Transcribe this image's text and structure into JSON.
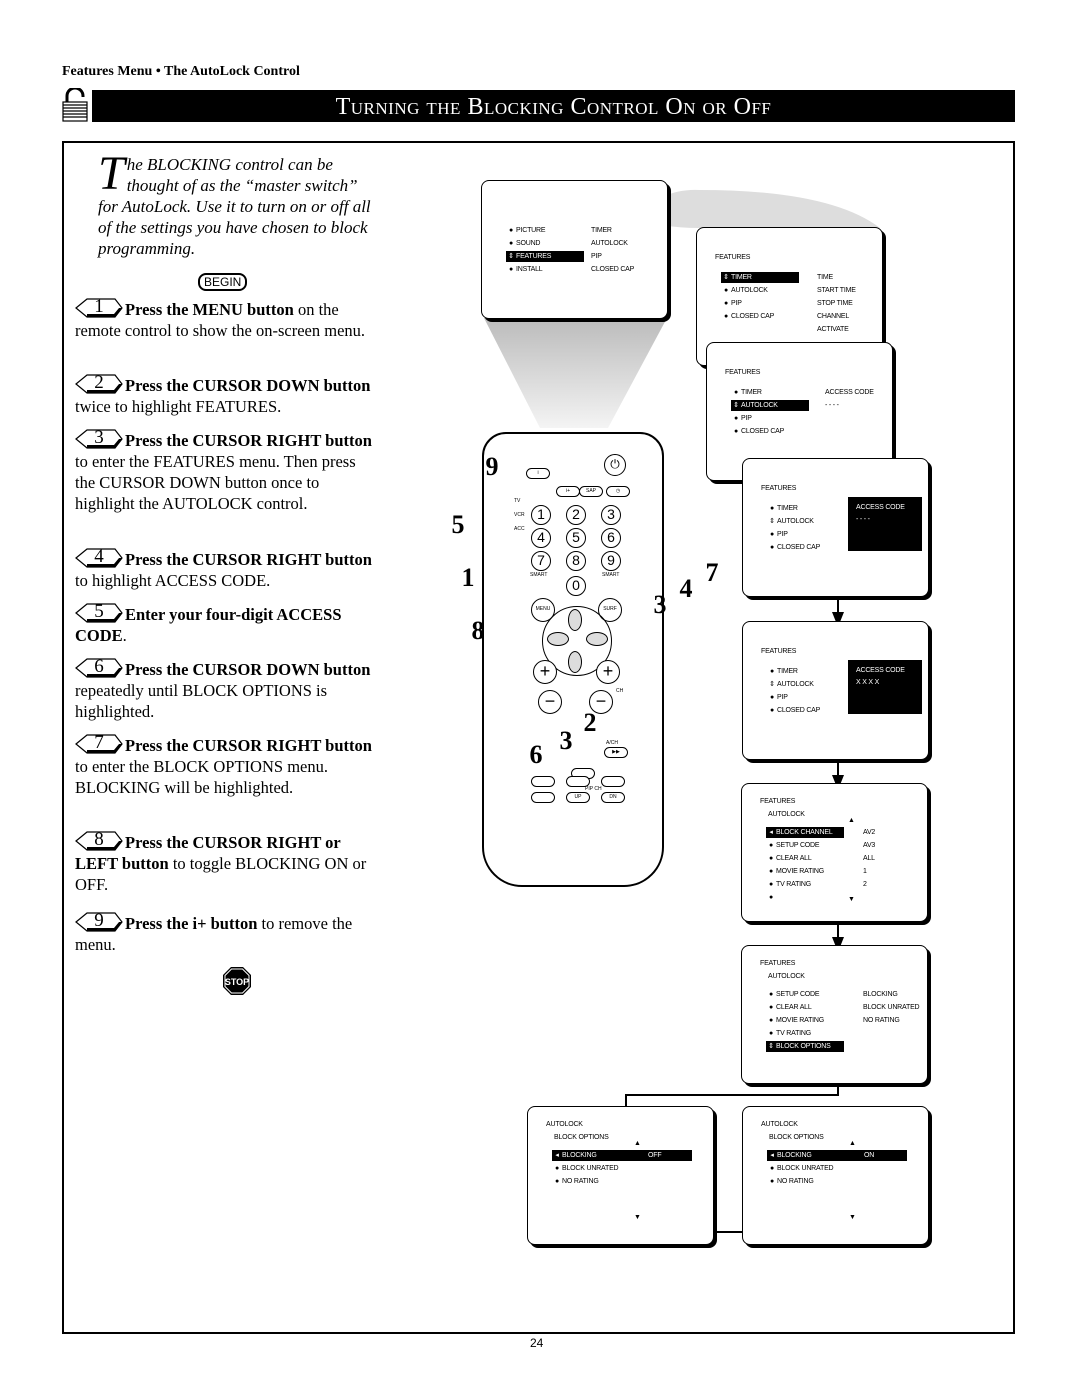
{
  "header": {
    "breadcrumb": "Features Menu • The AutoLock Control",
    "title": "Turning the Blocking Control On or Off",
    "icon": "padlock-open-icon"
  },
  "intro": {
    "drop_cap": "T",
    "text": "he BLOCKING control can be thought of as the “master switch” for AutoLock. Use it to turn on or off all of the settings you have chosen to block programming.",
    "begin_label": "BEGIN"
  },
  "steps": [
    {
      "num": "1",
      "bold": "Press the MENU button",
      "text": " on the remote control to show the on-screen menu."
    },
    {
      "num": "2",
      "bold": "Press the CURSOR DOWN button",
      "text": " twice to highlight FEATURES."
    },
    {
      "num": "3",
      "bold": "Press the CURSOR RIGHT button",
      "text": " to enter the FEATURES menu. Then press the CURSOR DOWN button once to highlight the AUTOLOCK control."
    },
    {
      "num": "4",
      "bold": "Press the CURSOR RIGHT button",
      "text": " to highlight ACCESS CODE."
    },
    {
      "num": "5",
      "bold": "Enter your four-digit ACCESS CODE",
      "text": "."
    },
    {
      "num": "6",
      "bold": "Press the CURSOR DOWN button",
      "text": " repeatedly until BLOCK OPTIONS is highlighted."
    },
    {
      "num": "7",
      "bold": "Press the CURSOR RIGHT button",
      "text": " to enter the BLOCK OPTIONS menu. BLOCKING will be highlighted."
    },
    {
      "num": "8",
      "bold": "Press the CURSOR RIGHT or LEFT button",
      "text": " to toggle BLOCKING ON or OFF."
    },
    {
      "num": "9",
      "bold": "Press the i+ button",
      "text": " to remove the menu."
    }
  ],
  "stop_label": "STOP",
  "page_number": "24",
  "remote": {
    "number_keys": [
      "1",
      "2",
      "3",
      "4",
      "5",
      "6",
      "7",
      "8",
      "9",
      "0"
    ],
    "labels": {
      "tv": "TV",
      "vcr": "VCR",
      "acc": "ACC",
      "smart_left": "SMART",
      "smart_right": "SMART",
      "menu": "MENU",
      "surf": "SURF",
      "sap": "SAP",
      "ch": "CH",
      "ach": "A/CH",
      "pipch": "PIP CH",
      "up": "UP",
      "dn": "DN"
    },
    "step_badges": [
      "9",
      "5",
      "1",
      "8",
      "3",
      "4",
      "7",
      "2",
      "3",
      "6"
    ]
  },
  "screens": [
    {
      "rows": [
        {
          "mk": "bullet",
          "t": "PICTURE"
        },
        {
          "mk": "bullet",
          "t": "SOUND"
        },
        {
          "mk": "updown",
          "t": "FEATURES",
          "hl": true
        },
        {
          "mk": "bullet",
          "t": "INSTALL"
        }
      ],
      "values": [
        "TIMER",
        "AUTOLOCK",
        "PIP",
        "CLOSED  CAP"
      ]
    },
    {
      "header": "FEATURES",
      "rows": [
        {
          "mk": "updown",
          "t": "TIMER",
          "hl": true
        },
        {
          "mk": "bullet",
          "t": "AUTOLOCK"
        },
        {
          "mk": "bullet",
          "t": "PIP"
        },
        {
          "mk": "bullet",
          "t": "CLOSED  CAP"
        }
      ],
      "values": [
        "TIME",
        "START  TIME",
        "STOP  TIME",
        "CHANNEL",
        "ACTIVATE"
      ]
    },
    {
      "header": "FEATURES",
      "rows": [
        {
          "mk": "bullet",
          "t": "TIMER"
        },
        {
          "mk": "updown",
          "t": "AUTOLOCK",
          "hl": true
        },
        {
          "mk": "bullet",
          "t": "PIP"
        },
        {
          "mk": "bullet",
          "t": "CLOSED  CAP"
        }
      ],
      "values": [
        "ACCESS  CODE",
        "-  -  -  -"
      ]
    },
    {
      "header": "FEATURES",
      "rows": [
        {
          "mk": "bullet",
          "t": "TIMER"
        },
        {
          "mk": "updown",
          "t": "AUTOLOCK"
        },
        {
          "mk": "bullet",
          "t": "PIP"
        },
        {
          "mk": "bullet",
          "t": "CLOSED  CAP"
        }
      ],
      "panel": [
        "ACCESS  CODE",
        "-  -  -  -"
      ]
    },
    {
      "header": "FEATURES",
      "rows": [
        {
          "mk": "bullet",
          "t": "TIMER"
        },
        {
          "mk": "updown",
          "t": "AUTOLOCK"
        },
        {
          "mk": "bullet",
          "t": "PIP"
        },
        {
          "mk": "bullet",
          "t": "CLOSED  CAP"
        }
      ],
      "panel": [
        "ACCESS  CODE",
        "X  X  X  X"
      ]
    },
    {
      "header": "FEATURES",
      "sub": "AUTOLOCK",
      "rows": [
        {
          "mk": "left",
          "t": "BLOCK  CHANNEL",
          "hl": true
        },
        {
          "mk": "bullet",
          "t": "SETUP  CODE"
        },
        {
          "mk": "bullet",
          "t": "CLEAR  ALL"
        },
        {
          "mk": "bullet",
          "t": "MOVIE  RATING"
        },
        {
          "mk": "bullet",
          "t": "TV  RATING"
        },
        {
          "mk": "bullet",
          "t": ""
        }
      ],
      "values": [
        "AV2",
        "AV3",
        "ALL",
        "1",
        "2"
      ],
      "scroll": true
    },
    {
      "header": "FEATURES",
      "sub": "AUTOLOCK",
      "rows": [
        {
          "mk": "bullet",
          "t": "SETUP  CODE"
        },
        {
          "mk": "bullet",
          "t": "CLEAR  ALL"
        },
        {
          "mk": "bullet",
          "t": "MOVIE  RATING"
        },
        {
          "mk": "bullet",
          "t": "TV  RATING"
        },
        {
          "mk": "updown",
          "t": "BLOCK  OPTIONS",
          "hl": true
        }
      ],
      "values": [
        "BLOCKING",
        "BLOCK  UNRATED",
        "NO  RATING"
      ]
    },
    {
      "header": "AUTOLOCK",
      "sub": "BLOCK  OPTIONS",
      "rows": [
        {
          "mk": "left",
          "t": "BLOCKING",
          "hl": true,
          "wide": true
        },
        {
          "mk": "bullet",
          "t": "BLOCK  UNRATED"
        },
        {
          "mk": "bullet",
          "t": "NO  RATING"
        }
      ],
      "values": [
        "OFF"
      ],
      "scroll": true
    },
    {
      "header": "AUTOLOCK",
      "sub": "BLOCK  OPTIONS",
      "rows": [
        {
          "mk": "left",
          "t": "BLOCKING",
          "hl": true,
          "wide": true
        },
        {
          "mk": "bullet",
          "t": "BLOCK  UNRATED"
        },
        {
          "mk": "bullet",
          "t": "NO  RATING"
        }
      ],
      "values": [
        "ON"
      ],
      "scroll": true
    }
  ]
}
